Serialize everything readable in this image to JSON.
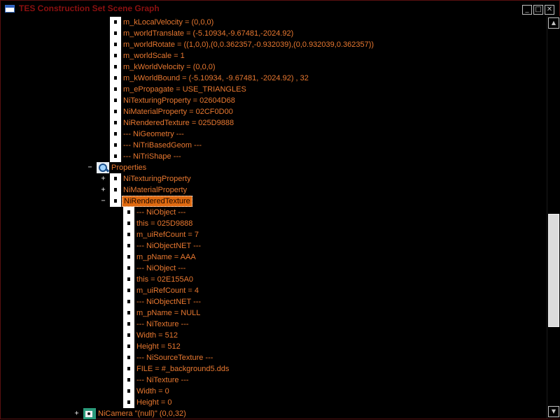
{
  "window": {
    "title": "TES Construction Set Scene Graph",
    "min_glyph": "_",
    "max_glyph": "□",
    "close_glyph": "✕"
  },
  "colors": {
    "accent": "#e87830",
    "selected_bg": "#e06a10",
    "title": "#8b1010",
    "background": "#000000"
  },
  "scrollbar": {
    "up_glyph": "▲",
    "down_glyph": "▼",
    "scroll_position": 0.7,
    "visible_fraction": 0.3
  },
  "tree": {
    "upper_items": [
      "m_kLocalVelocity = (0,0,0)",
      "m_worldTranslate = (-5.10934,-9.67481,-2024.92)",
      "m_worldRotate = ((1,0,0),(0,0.362357,-0.932039),(0,0.932039,0.362357))",
      "m_worldScale = 1",
      "m_kWorldVelocity = (0,0,0)",
      "m_kWorldBound = (-5.10934, -9.67481, -2024.92) , 32",
      "m_ePropagate = USE_TRIANGLES",
      "NiTexturingProperty = 02604D68",
      "NiMaterialProperty = 02CF0D00",
      "NiRenderedTexture = 025D9888",
      "--- NiGeometry ---",
      "--- NiTriBasedGeom ---",
      "--- NiTriShape ---"
    ],
    "properties": {
      "label": "Properties",
      "expander": "−",
      "icon": "magnifier-icon",
      "children": [
        {
          "label": "NiTexturingProperty",
          "expander": "+"
        },
        {
          "label": "NiMaterialProperty",
          "expander": "+"
        },
        {
          "label": "NiRenderedTexture",
          "expander": "−",
          "selected": true
        }
      ]
    },
    "texture_items": [
      "--- NiObject ---",
      "this = 025D9888",
      "m_uiRefCount = 7",
      "--- NiObjectNET ---",
      "m_pName = AAA",
      "--- NiObject ---",
      "this = 02E155A0",
      "m_uiRefCount = 4",
      "--- NiObjectNET ---",
      "m_pName = NULL",
      "--- NiTexture ---",
      "Width = 512",
      "Height = 512",
      "--- NiSourceTexture ---",
      "FILE = #_background5.dds",
      "--- NiTexture ---",
      "Width = 0",
      "Height = 0"
    ],
    "camera": {
      "label": "NiCamera \"(null)\" (0,0,32)",
      "expander": "+",
      "icon": "camera-icon"
    }
  }
}
